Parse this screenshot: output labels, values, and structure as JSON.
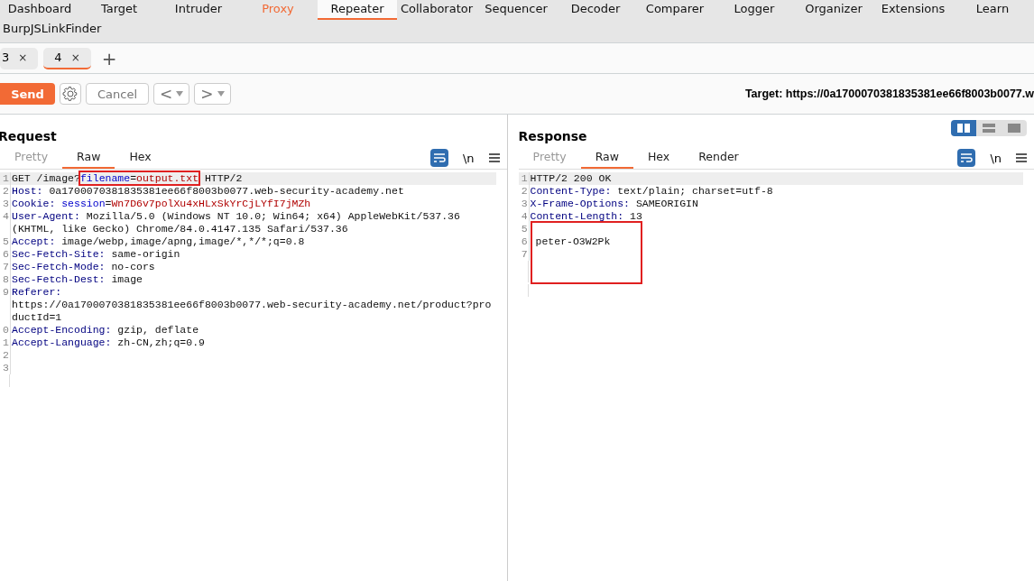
{
  "nav": [
    {
      "label": "Dashboard",
      "selected": false,
      "alert": false
    },
    {
      "label": "Target",
      "selected": false,
      "alert": false
    },
    {
      "label": "Intruder",
      "selected": false,
      "alert": false
    },
    {
      "label": "Proxy",
      "selected": false,
      "alert": true
    },
    {
      "label": "Repeater",
      "selected": true,
      "alert": false
    },
    {
      "label": "Collaborator",
      "selected": false,
      "alert": false
    },
    {
      "label": "Sequencer",
      "selected": false,
      "alert": false
    },
    {
      "label": "Decoder",
      "selected": false,
      "alert": false
    },
    {
      "label": "Comparer",
      "selected": false,
      "alert": false
    },
    {
      "label": "Logger",
      "selected": false,
      "alert": false
    },
    {
      "label": "Organizer",
      "selected": false,
      "alert": false
    },
    {
      "label": "Extensions",
      "selected": false,
      "alert": false
    },
    {
      "label": "Learn",
      "selected": false,
      "alert": false
    }
  ],
  "nav_row2": [
    {
      "label": "BurpJSLinkFinder",
      "selected": false,
      "alert": false
    }
  ],
  "session_tabs": [
    {
      "label": "3",
      "close": "×",
      "selected": false
    },
    {
      "label": "4",
      "close": "×",
      "selected": true
    }
  ],
  "add_tab": "+",
  "toolbar": {
    "send": "Send",
    "cancel": "Cancel",
    "back": "<",
    "forward": ">",
    "target": "Target: https://0a1700070381835381ee66f8003b0077.w"
  },
  "request": {
    "title": "Request",
    "tabs": [
      {
        "label": "Pretty",
        "selected": false,
        "disabled": true
      },
      {
        "label": "Raw",
        "selected": true,
        "disabled": false
      },
      {
        "label": "Hex",
        "selected": false,
        "disabled": false
      }
    ],
    "newline": "\\n",
    "rows": [
      {
        "number": "1",
        "current": true,
        "tokens": [
          {
            "text": "GET /image?",
            "kind": "plain"
          },
          {
            "kind": "frame",
            "tokens": [
              {
                "text": "filename",
                "kind": "param"
              },
              {
                "text": "=",
                "kind": "plain"
              },
              {
                "text": "output.txt",
                "kind": "value"
              }
            ]
          },
          {
            "text": " HTTP/2",
            "kind": "plain"
          }
        ]
      },
      {
        "number": "2",
        "current": false,
        "tokens": [
          {
            "text": "Host:",
            "kind": "name"
          },
          {
            "text": " 0a1700070381835381ee66f8003b0077.web-security-academy.net",
            "kind": "plain"
          }
        ]
      },
      {
        "number": "3",
        "current": false,
        "tokens": [
          {
            "text": "Cookie: ",
            "kind": "name"
          },
          {
            "text": "session",
            "kind": "param"
          },
          {
            "text": "=",
            "kind": "plain"
          },
          {
            "text": "Wn7D6v7polXu4xHLxSkYrCjLYfI7jMZh",
            "kind": "value"
          }
        ]
      },
      {
        "number": "4",
        "current": false,
        "tokens": [
          {
            "text": "User-Agent:",
            "kind": "name"
          },
          {
            "text": " Mozilla/5.0 (Windows NT 10.0; Win64; x64) AppleWebKit/537.36",
            "kind": "plain"
          }
        ]
      },
      {
        "number": "",
        "current": false,
        "tokens": [
          {
            "text": "(KHTML, like Gecko) Chrome/84.0.4147.135 Safari/537.36",
            "kind": "plain"
          }
        ]
      },
      {
        "number": "5",
        "current": false,
        "tokens": [
          {
            "text": "Accept:",
            "kind": "name"
          },
          {
            "text": " image/webp,image/apng,image/*,*/*;q=0.8",
            "kind": "plain"
          }
        ]
      },
      {
        "number": "6",
        "current": false,
        "tokens": [
          {
            "text": "Sec-Fetch-Site:",
            "kind": "name"
          },
          {
            "text": " same-origin",
            "kind": "plain"
          }
        ]
      },
      {
        "number": "7",
        "current": false,
        "tokens": [
          {
            "text": "Sec-Fetch-Mode:",
            "kind": "name"
          },
          {
            "text": " no-cors",
            "kind": "plain"
          }
        ]
      },
      {
        "number": "8",
        "current": false,
        "tokens": [
          {
            "text": "Sec-Fetch-Dest:",
            "kind": "name"
          },
          {
            "text": " image",
            "kind": "plain"
          }
        ]
      },
      {
        "number": "9",
        "current": false,
        "tokens": [
          {
            "text": "Referer:",
            "kind": "name"
          }
        ]
      },
      {
        "number": "",
        "current": false,
        "tokens": [
          {
            "text": "https://0a1700070381835381ee66f8003b0077.web-security-academy.net/product?pro",
            "kind": "plain"
          }
        ]
      },
      {
        "number": "",
        "current": false,
        "tokens": [
          {
            "text": "ductId=1",
            "kind": "plain"
          }
        ]
      },
      {
        "number": "0",
        "current": false,
        "tokens": [
          {
            "text": "Accept-Encoding:",
            "kind": "name"
          },
          {
            "text": " gzip, deflate",
            "kind": "plain"
          }
        ]
      },
      {
        "number": "1",
        "current": false,
        "tokens": [
          {
            "text": "Accept-Language:",
            "kind": "name"
          },
          {
            "text": " zh-CN,zh;q=0.9",
            "kind": "plain"
          }
        ]
      },
      {
        "number": "2",
        "current": false,
        "tokens": []
      },
      {
        "number": "3",
        "current": false,
        "tokens": []
      }
    ]
  },
  "response": {
    "title": "Response",
    "tabs": [
      {
        "label": "Pretty",
        "selected": false,
        "disabled": true
      },
      {
        "label": "Raw",
        "selected": true,
        "disabled": false
      },
      {
        "label": "Hex",
        "selected": false,
        "disabled": false
      },
      {
        "label": "Render",
        "selected": false,
        "disabled": false
      }
    ],
    "newline": "\\n",
    "layouts": [
      {
        "selected": true
      },
      {
        "selected": false
      },
      {
        "selected": false
      }
    ],
    "rows": [
      {
        "kind": "line",
        "number": "1",
        "current": true,
        "tokens": [
          {
            "text": "HTTP/2 200 OK",
            "kind": "plain"
          }
        ]
      },
      {
        "kind": "line",
        "number": "2",
        "current": false,
        "tokens": [
          {
            "text": "Content-Type:",
            "kind": "name"
          },
          {
            "text": " text/plain; charset=utf-8",
            "kind": "plain"
          }
        ]
      },
      {
        "kind": "line",
        "number": "3",
        "current": false,
        "tokens": [
          {
            "text": "X-Frame-Options:",
            "kind": "name"
          },
          {
            "text": " SAMEORIGIN",
            "kind": "plain"
          }
        ]
      },
      {
        "kind": "line",
        "number": "4",
        "current": false,
        "tokens": [
          {
            "text": "Content-Length:",
            "kind": "name"
          },
          {
            "text": " 13",
            "kind": "plain"
          }
        ]
      },
      {
        "kind": "frame",
        "rows": [
          {
            "number": "5",
            "current": false,
            "tokens": []
          },
          {
            "number": "6",
            "current": false,
            "tokens": [
              {
                "text": "peter-O3W2Pk",
                "kind": "plain"
              }
            ]
          },
          {
            "number": "7",
            "current": false,
            "tokens": []
          }
        ]
      }
    ]
  }
}
